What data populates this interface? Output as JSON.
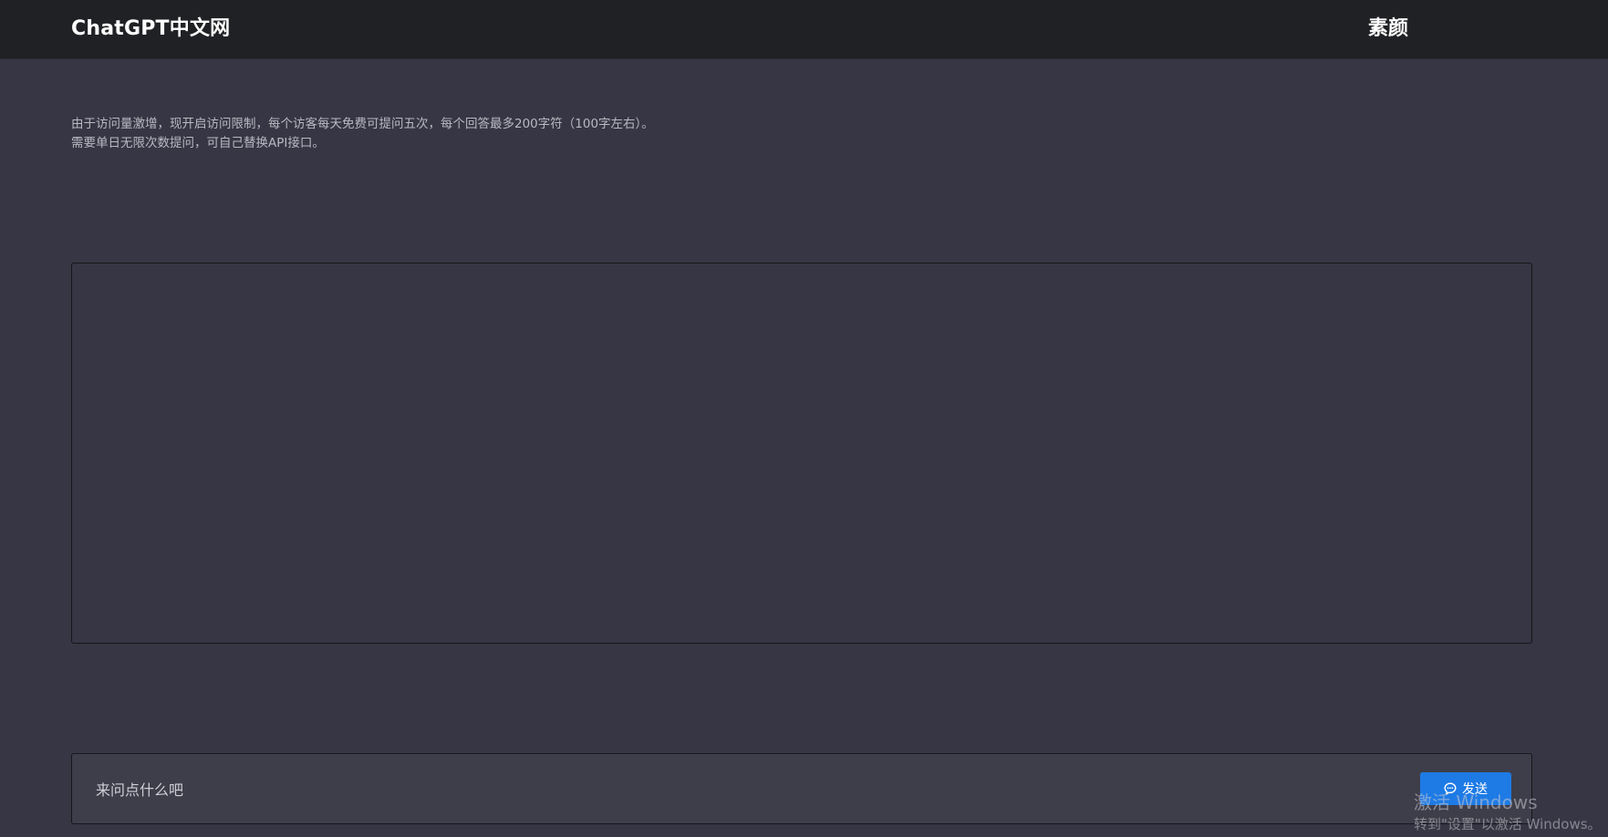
{
  "header": {
    "brand": "ChatGPT中文网",
    "user": "素颜"
  },
  "notice": {
    "line1": "由于访问量激增，现开启访问限制，每个访客每天免费可提问五次，每个回答最多200字符（100字左右）。",
    "line2": "需要单日无限次数提问，可自己替换API接口。"
  },
  "composer": {
    "placeholder": "来问点什么吧",
    "send_label": "发送",
    "send_icon": "chat-bubble-icon"
  },
  "watermark": {
    "line1": "激活 Windows",
    "line2": "转到\"设置\"以激活 Windows。"
  },
  "colors": {
    "background": "#363644",
    "header": "#202124",
    "accent": "#1e7be5"
  }
}
